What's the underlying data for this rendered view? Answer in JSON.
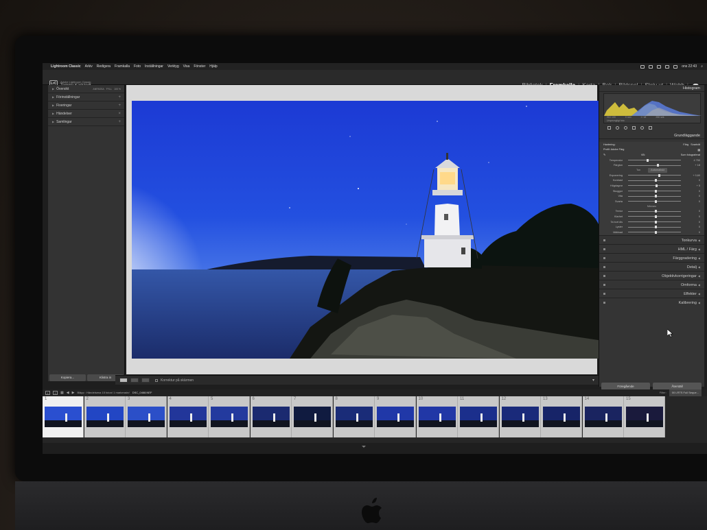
{
  "menubar": {
    "items": [
      "Lightroom Classic",
      "Arkiv",
      "Redigera",
      "Framkalla",
      "Foto",
      "Inställningar",
      "Verktyg",
      "Visa",
      "Fönster",
      "Hjälp"
    ],
    "clock": "ons 22:43"
  },
  "identity": {
    "badge": "LrC",
    "product": "Adobe Lightroom Classic",
    "user": "Tommy Karlstedt"
  },
  "modules": [
    "Bibliotek",
    "Framkalla",
    "Karta",
    "Bok",
    "Bildspel",
    "Skriv ut",
    "Webb"
  ],
  "active_module": "Framkalla",
  "left_panel": {
    "overview": {
      "label": "Översikt",
      "fit": "ANPASSA",
      "fill": "FYLL",
      "zoom": "100 %"
    },
    "sections": [
      "Förinställningar",
      "Fixeringar",
      "Händelser",
      "Samlingar"
    ],
    "buttons": [
      "Kopiera...",
      "Klistra in"
    ]
  },
  "toolbar": {
    "softproof": "Korrektur på skärmen"
  },
  "right_panel": {
    "histogram_label": "Histogram",
    "histo_info": [
      "ISO 100",
      "0 mm",
      "f / 18",
      "250 sek"
    ],
    "original_photo": "Ursprungligt foto",
    "basic_label": "Grundläggande",
    "treatment": {
      "label": "Hantering:",
      "color": "Färg",
      "bw": "Svartvitt"
    },
    "profile": {
      "label": "Profil:",
      "value": "Adobe Färg"
    },
    "wb": {
      "label": "VB:",
      "value": "Som fotograferat"
    },
    "tone_label": "Ton",
    "auto_label": "Automatiskt",
    "presence_label": "Närvaro",
    "sliders": [
      {
        "label": "Temperatur",
        "value": "4 750",
        "pos": 0.35
      },
      {
        "label": "Färgton",
        "value": "+ 18",
        "pos": 0.55
      },
      {
        "label": "Exponering",
        "value": "+ 0,60",
        "pos": 0.57
      },
      {
        "label": "Kontrast",
        "value": "0",
        "pos": 0.5
      },
      {
        "label": "Högdagrar",
        "value": "+ 5",
        "pos": 0.52
      },
      {
        "label": "Skuggor",
        "value": "0",
        "pos": 0.5
      },
      {
        "label": "Vita",
        "value": "0",
        "pos": 0.5
      },
      {
        "label": "Svarta",
        "value": "0",
        "pos": 0.5
      },
      {
        "label": "Textur",
        "value": "0",
        "pos": 0.5
      },
      {
        "label": "Klarhet",
        "value": "0",
        "pos": 0.5
      },
      {
        "label": "Ta bort dis",
        "value": "0",
        "pos": 0.5
      },
      {
        "label": "Lyster",
        "value": "0",
        "pos": 0.5
      },
      {
        "label": "Mättnad",
        "value": "0",
        "pos": 0.5
      }
    ],
    "panels": [
      "Tonkurva",
      "HML / Färg",
      "Färggradering",
      "Detalj",
      "Objektivkorrigeringar",
      "Omforma",
      "Effekter",
      "Kalibrering"
    ],
    "buttons": [
      "Föregående",
      "Återställ"
    ]
  },
  "filmstrip": {
    "path": "Bläpp : Händelsena   15 foton/   1 markerade/",
    "file": "DSC_0468.NEF",
    "filter_label": "Filter:",
    "filter_value": "00 LRTS Full Seque...",
    "frames": [
      "1",
      "2",
      "3",
      "4",
      "5",
      "6",
      "7",
      "8",
      "9",
      "10",
      "11",
      "12",
      "13",
      "14",
      "15"
    ],
    "selected": 0
  },
  "colors": {
    "sky_top": "#1a3bd6",
    "sky_horizon": "#ffe6cc",
    "panel": "#343434",
    "accent_hist": "#e8d23c"
  }
}
